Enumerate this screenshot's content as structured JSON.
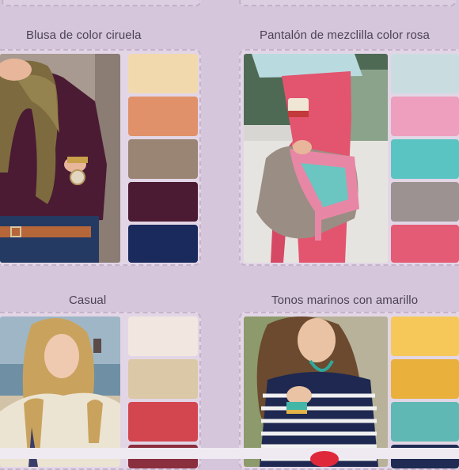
{
  "sections": [
    {
      "title": "Blusa de color ciruela",
      "photo": "woman in plum blouse with olive scarf and jeans",
      "swatches": [
        "#f2d9ad",
        "#e0916a",
        "#9a8473",
        "#4b1b33",
        "#1b2a5d"
      ]
    },
    {
      "title": "Pantalón de mezclilla color rosa",
      "photo": "pink jeans with embroidered clutch bag",
      "swatches": [
        "#c9dde0",
        "#ee9fbd",
        "#5ac4c3",
        "#9c9291",
        "#e35b74"
      ]
    },
    {
      "title": "Casual",
      "photo": "blonde woman in cream knit sweater at the beach",
      "swatches": [
        "#f1e7e0",
        "#dbc8a6",
        "#d3464f",
        "#8a2f3e"
      ]
    },
    {
      "title": "Tonos marinos con amarillo",
      "photo": "woman in navy striped top with turquoise necklace",
      "swatches": [
        "#f6c85a",
        "#eab03c",
        "#5fb8b3",
        "#1f2b52"
      ]
    }
  ]
}
